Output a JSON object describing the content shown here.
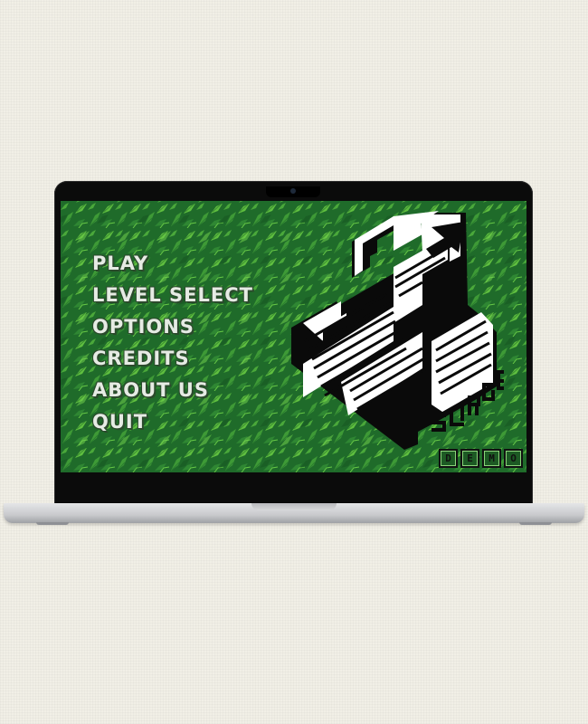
{
  "menu": {
    "items": [
      "PLAY",
      "LEVEL SELECT",
      "OPTIONS",
      "CREDITS",
      "ABOUT US",
      "QUIT"
    ]
  },
  "logo": {
    "brand": "SURGE",
    "badge": [
      "D",
      "E",
      "M",
      "O"
    ]
  },
  "colors": {
    "background": "#f1efe6",
    "leaf_dark": "#1f6b2a",
    "leaf_light": "#5fbf3f",
    "menu_text": "#e6ebe4",
    "bezel": "#0b0b0b",
    "laptop_body": "#c8c9cc"
  }
}
